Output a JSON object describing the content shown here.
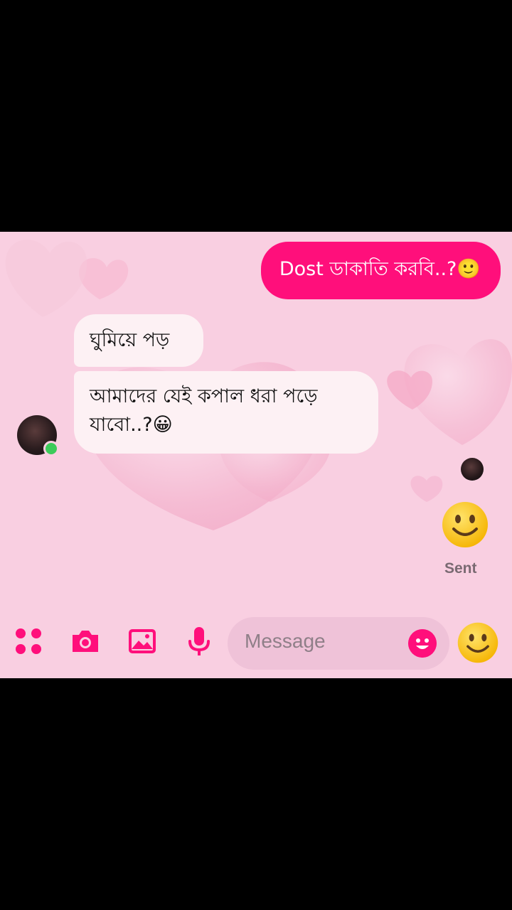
{
  "thread": {
    "outgoing_message": "Dost  ডাকাতি করবি..?🙂",
    "incoming_messages": [
      "ঘুমিয়ে পড়",
      "আমাদের যেই কপাল ধরা পড়ে যাবো..?😀"
    ],
    "status_text": "Sent"
  },
  "composer": {
    "placeholder": "Message",
    "icons": [
      "apps-icon",
      "camera-icon",
      "gallery-icon",
      "mic-icon",
      "emoji-icon",
      "like-emoji-icon"
    ]
  },
  "colors": {
    "accent": "#ff0f7b",
    "chat_background": "#f9cfe1",
    "incoming_bubble": "#fdf1f4",
    "online": "#3ccb5a"
  }
}
